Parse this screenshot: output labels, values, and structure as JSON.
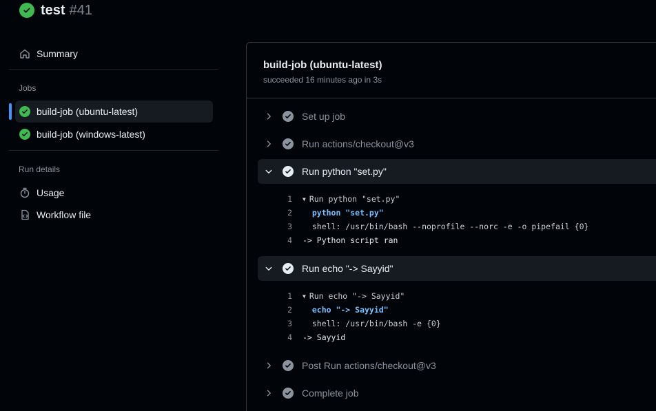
{
  "header": {
    "title": "test",
    "run_number": "#41"
  },
  "sidebar": {
    "summary_label": "Summary",
    "jobs_label": "Jobs",
    "jobs": [
      {
        "label": "build-job (ubuntu-latest)",
        "active": true
      },
      {
        "label": "build-job (windows-latest)",
        "active": false
      }
    ],
    "run_details_label": "Run details",
    "usage_label": "Usage",
    "workflow_file_label": "Workflow file"
  },
  "job": {
    "title": "build-job (ubuntu-latest)",
    "subtitle": "succeeded 16 minutes ago in 3s"
  },
  "steps": [
    {
      "label": "Set up job",
      "expanded": false
    },
    {
      "label": "Run actions/checkout@v3",
      "expanded": false
    },
    {
      "label": "Run python \"set.py\"",
      "expanded": true,
      "log": [
        {
          "n": "1",
          "text": "Run python \"set.py\"",
          "kind": "group"
        },
        {
          "n": "2",
          "text": "  python \"set.py\"",
          "kind": "cmd"
        },
        {
          "n": "3",
          "text": "  shell: /usr/bin/bash --noprofile --norc -e -o pipefail {0}",
          "kind": "shell"
        },
        {
          "n": "4",
          "text": "-> Python script ran",
          "kind": "out"
        }
      ]
    },
    {
      "label": "Run echo \"-> Sayyid\"",
      "expanded": true,
      "log": [
        {
          "n": "1",
          "text": "Run echo \"-> Sayyid\"",
          "kind": "group"
        },
        {
          "n": "2",
          "text": "  echo \"-> Sayyid\"",
          "kind": "cmd"
        },
        {
          "n": "3",
          "text": "  shell: /usr/bin/bash -e {0}",
          "kind": "shell"
        },
        {
          "n": "4",
          "text": "-> Sayyid",
          "kind": "out"
        }
      ]
    },
    {
      "label": "Post Run actions/checkout@v3",
      "expanded": false
    },
    {
      "label": "Complete job",
      "expanded": false
    }
  ],
  "colors": {
    "success": "#3fb950",
    "accent": "#4493f8",
    "muted": "#8b949e",
    "command": "#79c0ff"
  }
}
